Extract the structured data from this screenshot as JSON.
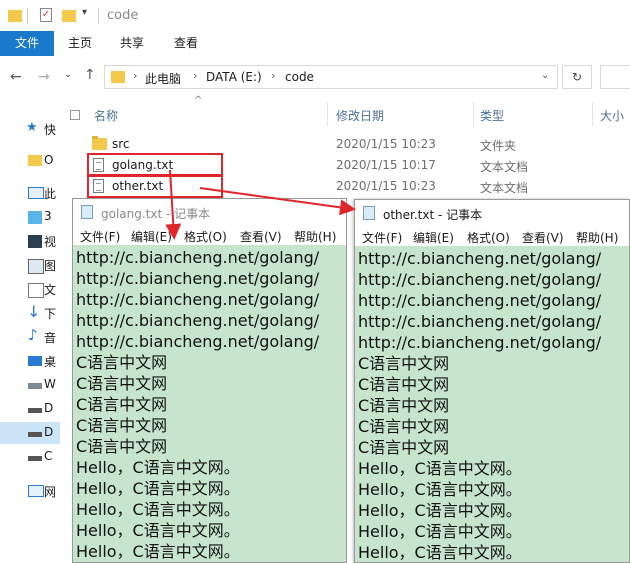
{
  "window": {
    "title": "code"
  },
  "ribbon": {
    "tabs": [
      "文件",
      "主页",
      "共享",
      "查看"
    ]
  },
  "address": {
    "crumbs": [
      "此电脑",
      "DATA (E:)",
      "code"
    ]
  },
  "sidebar": {
    "items": [
      "快",
      "O",
      "此",
      "3",
      "视",
      "图",
      "文",
      "下",
      "音",
      "桌",
      "W",
      "D",
      "D",
      "C",
      "网"
    ]
  },
  "columns": {
    "name": "名称",
    "date": "修改日期",
    "type": "类型",
    "size": "大小"
  },
  "files": [
    {
      "name": "src",
      "date": "2020/1/15 10:23",
      "type": "文件夹",
      "icon": "folder-icon"
    },
    {
      "name": "golang.txt",
      "date": "2020/1/15 10:17",
      "type": "文本文档",
      "icon": "text-file-icon"
    },
    {
      "name": "other.txt",
      "date": "2020/1/15 10:23",
      "type": "文本文档",
      "icon": "text-file-icon"
    }
  ],
  "notepad_left": {
    "title": "golang.txt - 记事本",
    "menu": [
      "文件(F)",
      "编辑(E)",
      "格式(O)",
      "查看(V)",
      "帮助(H)"
    ],
    "lines": [
      "http://c.biancheng.net/golang/",
      "http://c.biancheng.net/golang/",
      "http://c.biancheng.net/golang/",
      "http://c.biancheng.net/golang/",
      "http://c.biancheng.net/golang/",
      "C语言中文网",
      "C语言中文网",
      "C语言中文网",
      "C语言中文网",
      "C语言中文网",
      "Hello，C语言中文网。",
      "Hello，C语言中文网。",
      "Hello，C语言中文网。",
      "Hello，C语言中文网。",
      "Hello，C语言中文网。"
    ]
  },
  "notepad_right": {
    "title": "other.txt - 记事本",
    "menu": [
      "文件(F)",
      "编辑(E)",
      "格式(O)",
      "查看(V)",
      "帮助(H)"
    ],
    "lines": [
      "http://c.biancheng.net/golang/",
      "http://c.biancheng.net/golang/",
      "http://c.biancheng.net/golang/",
      "http://c.biancheng.net/golang/",
      "http://c.biancheng.net/golang/",
      "C语言中文网",
      "C语言中文网",
      "C语言中文网",
      "C语言中文网",
      "C语言中文网",
      "Hello，C语言中文网。",
      "Hello，C语言中文网。",
      "Hello，C语言中文网。",
      "Hello，C语言中文网。",
      "Hello，C语言中文网。"
    ]
  },
  "colors": {
    "accent": "#1979ca",
    "annotation": "#e0252b",
    "notepad_bg": "#c6e5cc"
  }
}
